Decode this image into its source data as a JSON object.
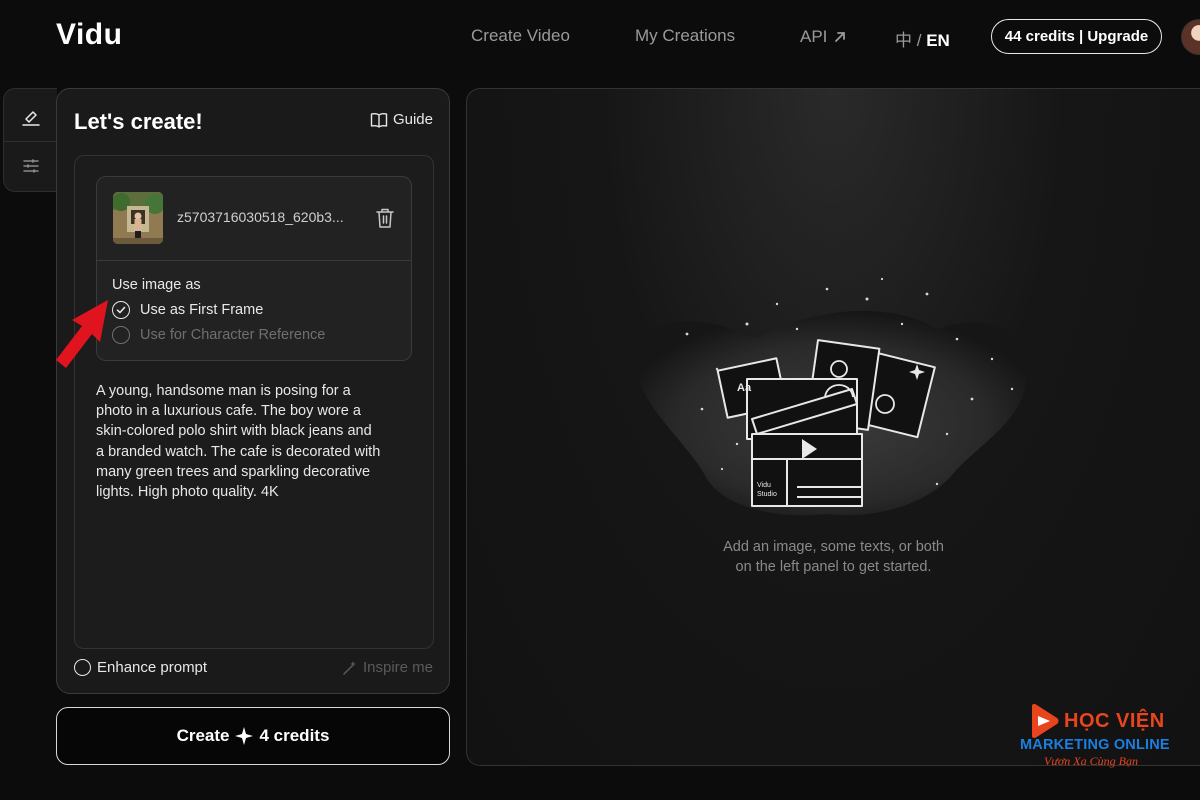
{
  "header": {
    "logo": "Vidu",
    "nav": {
      "create_video": "Create Video",
      "my_creations": "My Creations",
      "api": "API"
    },
    "language": {
      "zh": "中",
      "separator": "/",
      "en": "EN"
    },
    "credits_button": "44 credits | Upgrade"
  },
  "tools": [
    {
      "icon": "edit-icon"
    },
    {
      "icon": "sliders-icon"
    }
  ],
  "create_panel": {
    "title": "Let's create!",
    "guide_label": "Guide",
    "upload": {
      "filename": "z5703716030518_620b3...",
      "use_as_label": "Use image as",
      "options": [
        {
          "label": "Use as First Frame",
          "selected": true
        },
        {
          "label": "Use for Character Reference",
          "selected": false
        }
      ]
    },
    "prompt_lines": [
      "A young, handsome man is posing for a",
      "photo in a luxurious cafe. The boy wore a",
      "skin-colored polo shirt with black jeans and",
      "a branded watch. The cafe is decorated with",
      "many green trees and sparkling decorative",
      "lights. High photo quality. 4K"
    ],
    "enhance_label": "Enhance prompt",
    "inspire_label": "Inspire me"
  },
  "create_button": {
    "label": "Create",
    "credits": "4 credits"
  },
  "preview": {
    "clapper_text_line1": "Vidu",
    "clapper_text_line2": "Studio",
    "card_label": "Aa",
    "hint_line1": "Add an image, some texts, or both",
    "hint_line2": "on the left panel to get started."
  },
  "watermark": {
    "brand": "HỌC VIỆN",
    "subtitle": "MARKETING ONLINE",
    "slogan": "Vươn Xa Cùng Bạn"
  },
  "colors": {
    "background": "#0c0c0c",
    "panel": "#1a1a1a",
    "annotation_arrow": "#e0141e",
    "watermark_orange": "#e8451e",
    "watermark_blue": "#1b7fe0"
  }
}
